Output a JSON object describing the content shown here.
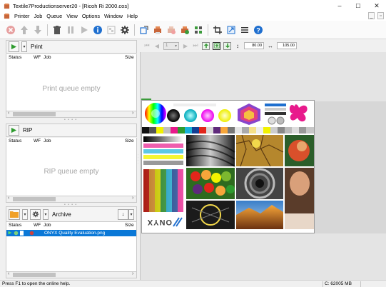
{
  "window": {
    "title": "Textile7Productionserver20 - [Ricoh Ri 2000.cos]",
    "controls": {
      "minimize": "–",
      "maximize": "☐",
      "close": "✕"
    }
  },
  "menu": {
    "items": [
      "Printer",
      "Job",
      "Queue",
      "View",
      "Options",
      "Window",
      "Help"
    ],
    "mdi": {
      "minimize": "_",
      "restore": "▫"
    }
  },
  "toolbar": {
    "icons": [
      "cancel-icon",
      "move-up-icon",
      "move-down-icon",
      "delete-icon",
      "pause-icon",
      "play-icon",
      "info-icon",
      "tile-icon",
      "settings-icon",
      "crop-icon",
      "printer-icon",
      "printer-cancel-icon",
      "printer-settings-icon",
      "pattern-icon",
      "crop-tool-icon",
      "resize-icon",
      "list-icon",
      "help-icon"
    ]
  },
  "print_panel": {
    "label": "Print",
    "columns": {
      "status": "Status",
      "wf": "WF",
      "job": "Job",
      "size": "Size"
    },
    "empty_message": "Print queue empty"
  },
  "rip_panel": {
    "label": "RIP",
    "columns": {
      "status": "Status",
      "wf": "WF",
      "job": "Job",
      "size": "Size"
    },
    "empty_message": "RIP queue empty"
  },
  "archive_panel": {
    "label": "Archive",
    "sort_label": "↓",
    "columns": {
      "status": "Status",
      "wf": "WF",
      "job": "Job",
      "size": "Size"
    },
    "rows": [
      {
        "job": "ONYX Quality Evaluation.png"
      }
    ]
  },
  "preview": {
    "page_value": "1",
    "height_value": "80.00",
    "width_value": "105.00",
    "image_logo_text": "ONYX"
  },
  "statusbar": {
    "help": "Press F1 to open the online help.",
    "memory": "C: 62005 MB"
  },
  "colors": {
    "accent": "#0a78d7",
    "green": "#3b9b3b",
    "play_green": "#2e9b2e"
  }
}
